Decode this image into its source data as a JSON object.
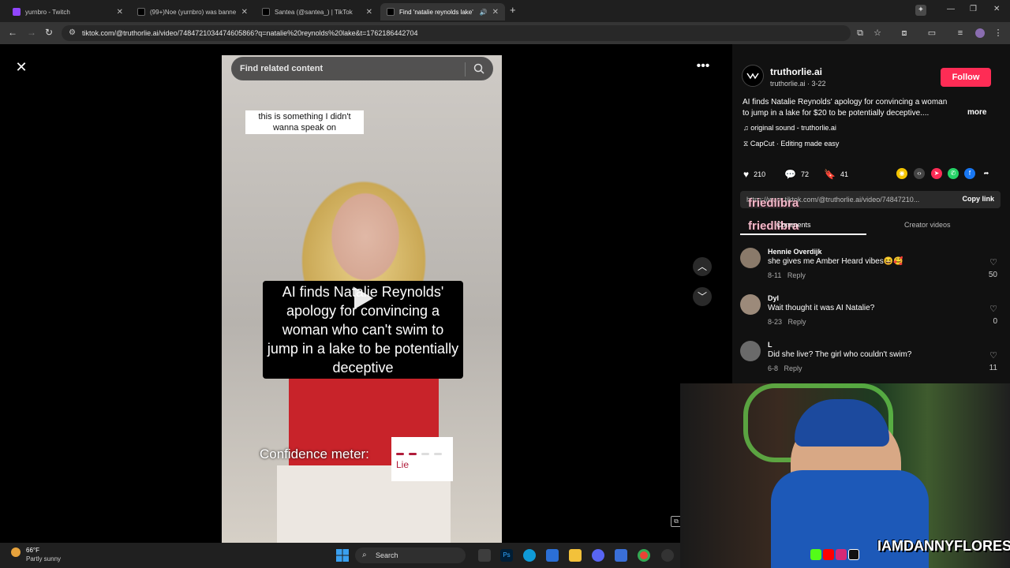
{
  "browser": {
    "tabs": [
      {
        "title": "yurnbro - Twitch",
        "color": "#9146ff",
        "active": false
      },
      {
        "title": "(99+)Noe (yurnbro) was banne",
        "color": "#111111",
        "active": false
      },
      {
        "title": "Santea (@santea_) | TikTok",
        "color": "#111111",
        "active": false
      },
      {
        "title": "Find 'natalie reynolds lake'",
        "color": "#111111",
        "active": true
      }
    ],
    "new_tab": "+",
    "url": "tiktok.com/@truthorlie.ai/video/7484721034474605866?q=natalie%20reynolds%20lake&t=1762186442704"
  },
  "player": {
    "search_placeholder": "Find related content",
    "subtitle": "this is something I didn't wanna speak on",
    "caption": "AI finds Natalie Reynolds' apology for convincing a woman who can't swim to jump in a lake to be potentially deceptive",
    "confidence_label": "Confidence meter:",
    "meter_value": "Lie",
    "meter_colors": [
      "#b01c3a",
      "#b01c3a",
      "#dddddd",
      "#dddddd"
    ],
    "more": "•••"
  },
  "panel": {
    "username": "truthorlie.ai",
    "subline": "truthorlie.ai · 3-22",
    "follow": "Follow",
    "description": "AI finds Natalie Reynolds' apology for convincing a woman to jump in a lake for $20 to be potentially deceptive....",
    "more": "more",
    "sound": "original sound - truthorlie.ai",
    "capcut": "CapCut · Editing made easy",
    "likes": "210",
    "comments_count": "72",
    "saves": "41",
    "link": "https://www.tiktok.com/@truthorlie.ai/video/74847210...",
    "copy_link": "Copy link",
    "overlay_text": "friedlibra",
    "tab_comments": "Comments",
    "tab_creator": "Creator videos",
    "comments": [
      {
        "name": "Hennie Overdijk",
        "text": "she gives me Amber Heard vibes😆🥰",
        "date": "8-11",
        "reply": "Reply",
        "likes": "50"
      },
      {
        "name": "Dyl",
        "text": "Wait thought it was AI Natalie?",
        "date": "8-23",
        "reply": "Reply",
        "likes": "0"
      },
      {
        "name": "L",
        "text": "Did she live? The girl who couldn't swim?",
        "date": "6-8",
        "reply": "Reply",
        "likes": "11"
      }
    ]
  },
  "webcam": {
    "handle": "IAMDANNYFLORES"
  },
  "taskbar": {
    "temp": "66°F",
    "condition": "Partly sunny",
    "search": "Search"
  }
}
